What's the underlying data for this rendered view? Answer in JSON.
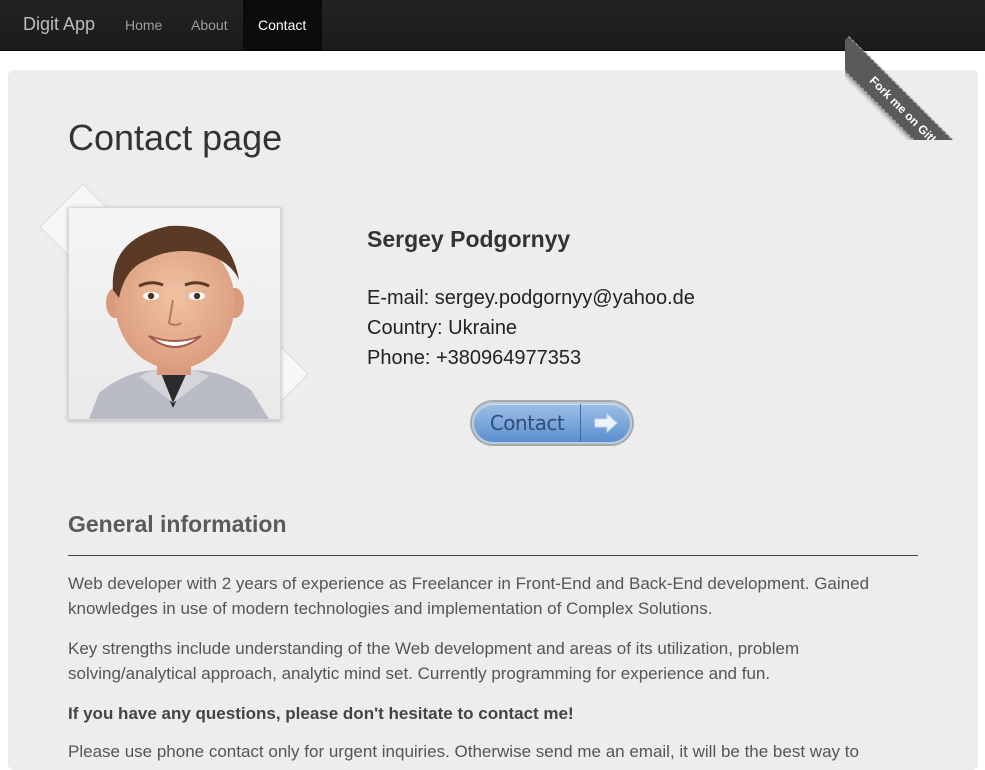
{
  "navbar": {
    "brand": "Digit App",
    "links": [
      "Home",
      "About",
      "Contact"
    ],
    "active": "Contact"
  },
  "ribbon": {
    "label": "Fork me on GitHub"
  },
  "page": {
    "title": "Contact page"
  },
  "profile": {
    "name": "Sergey Podgornyy",
    "email": "E-mail: sergey.podgornyy@yahoo.de",
    "country": "Country: Ukraine",
    "phone": "Phone: +380964977353",
    "contact_button": "Contact",
    "button_icon": "arrow-right-icon"
  },
  "general": {
    "title": "General information",
    "paragraphs": [
      "Web developer with 2 years of experience as Freelancer in Front-End and Back-End development. Gained knowledges in use of modern technologies and implementation of Complex Solutions.",
      "Key strengths include understanding of the Web development and areas of its utilization, problem solving/analytical approach, analytic mind set. Currently programming for experience and fun."
    ],
    "emphasis": "If you have any questions, please don't hesitate to contact me!",
    "last_line": "Please use phone contact only for urgent inquiries. Otherwise send me an email, it will be the best way to"
  },
  "colors": {
    "navbar": "#1f1f1f",
    "panel": "#ededed",
    "button": "#6f9ad4"
  }
}
